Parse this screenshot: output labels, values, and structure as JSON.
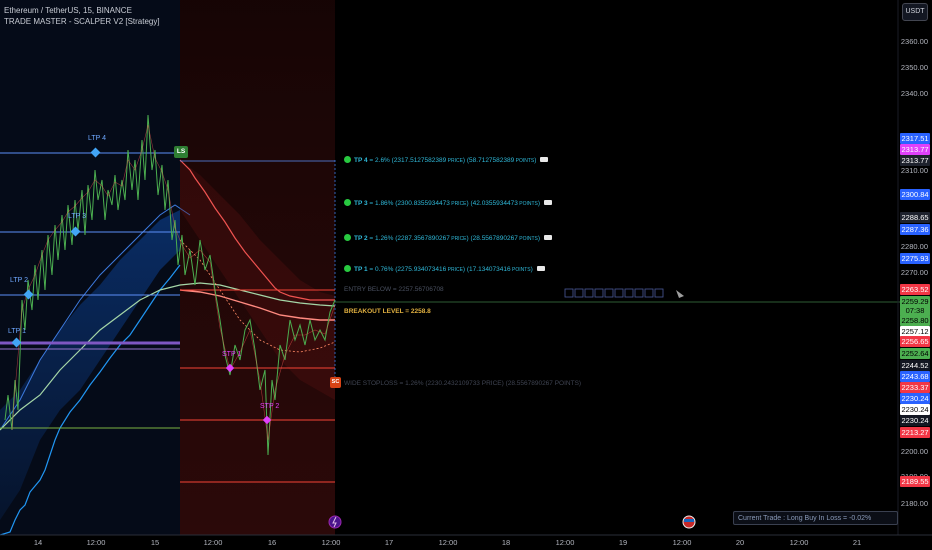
{
  "header": {
    "symbol": "Ethereum / TetherUS, 15, BINANCE",
    "strategy": "TRADE MASTER - SCALPER V2 [Strategy]"
  },
  "currency_button": "USDT",
  "price_axis": [
    "2360.00",
    "2350.00",
    "2340.00",
    "2310.00",
    "2280.00",
    "2270.00",
    "2200.00",
    "2190.00",
    "2180.00"
  ],
  "price_tags": [
    {
      "text": "2317.51",
      "bg": "#2962ff",
      "fg": "#ffffff"
    },
    {
      "text": "2313.77",
      "bg": "#e040fb",
      "fg": "#ffffff"
    },
    {
      "text": "2313.77",
      "bg": "#1e222d",
      "fg": "#ffffff"
    },
    {
      "text": "2300.84",
      "bg": "#2962ff",
      "fg": "#ffffff"
    },
    {
      "text": "2288.65",
      "bg": "#1e222d",
      "fg": "#ffffff"
    },
    {
      "text": "2287.36",
      "bg": "#2962ff",
      "fg": "#ffffff"
    },
    {
      "text": "2275.93",
      "bg": "#2962ff",
      "fg": "#ffffff"
    },
    {
      "text": "2263.52",
      "bg": "#f23645",
      "fg": "#ffffff"
    },
    {
      "text": "2259.29",
      "bg": "#4caf50",
      "fg": "#000000"
    },
    {
      "text": "07:38",
      "bg": "#4caf50",
      "fg": "#000000"
    },
    {
      "text": "2258.80",
      "bg": "#4caf50",
      "fg": "#000000"
    },
    {
      "text": "2257.12",
      "bg": "#ffffff",
      "fg": "#000000"
    },
    {
      "text": "2256.65",
      "bg": "#f23645",
      "fg": "#ffffff"
    },
    {
      "text": "2252.64",
      "bg": "#4caf50",
      "fg": "#000000"
    },
    {
      "text": "2244.52",
      "bg": "#131722",
      "fg": "#ffffff"
    },
    {
      "text": "2243.68",
      "bg": "#2962ff",
      "fg": "#ffffff"
    },
    {
      "text": "2233.37",
      "bg": "#f23645",
      "fg": "#ffffff"
    },
    {
      "text": "2230.24",
      "bg": "#2962ff",
      "fg": "#ffffff"
    },
    {
      "text": "2230.24",
      "bg": "#ffffff",
      "fg": "#000000"
    },
    {
      "text": "2230.24",
      "bg": "#131722",
      "fg": "#ffffff"
    },
    {
      "text": "2213.27",
      "bg": "#f23645",
      "fg": "#ffffff"
    },
    {
      "text": "2189.55",
      "bg": "#f23645",
      "fg": "#ffffff"
    }
  ],
  "time_axis": [
    "14",
    "12:00",
    "15",
    "12:00",
    "16",
    "12:00",
    "17",
    "12:00",
    "18",
    "12:00",
    "19",
    "12:00",
    "20",
    "12:00",
    "21"
  ],
  "targets": [
    {
      "label": "TP 4",
      "eq": " = 2.6% (",
      "price": "2317.5127582389",
      "pw": " PRICE",
      ")": ") (",
      "pts": "58.7127582389",
      "pts_w": " POINTS",
      ")2": ")"
    },
    {
      "label": "TP 3",
      "eq": " = 1.86% (",
      "price": "2300.8355934473",
      "pw": " PRICE",
      ")": ") (",
      "pts": "42.0355934473",
      "pts_w": " POINTS",
      ")2": ")"
    },
    {
      "label": "TP 2",
      "eq": " = 1.26% (",
      "price": "2287.3567890267",
      "pw": " PRICE",
      ")": ") (",
      "pts": "28.5567890267",
      "pts_w": " POINTS",
      ")2": ")"
    },
    {
      "label": "TP 1",
      "eq": " = 0.76% (",
      "price": "2275.934073416",
      "pw": " PRICE",
      ")": ") (",
      "pts": "17.134073416",
      "pts_w": " POINTS",
      ")2": ")"
    }
  ],
  "entry_below": "ENTRY BELOW = 2257.56706708",
  "breakout": "BREAKOUT LEVEL = 2258.8",
  "wide_stop": "WIDE STOPLOSS = 1.26% (2230.2432109733 PRICE) (28.5567890267 POINTS)",
  "markers": {
    "ltp4": "LTP 4",
    "ltp3": "LTP 3",
    "ltp2": "LTP 2",
    "ltp1": "LTP 1",
    "stp1": "STP 1",
    "stp2": "STP 2",
    "ls": "LS",
    "sc": "SC"
  },
  "status_bubble": "Current Trade : Long Buy  In Loss = -0.02%",
  "colors": {
    "tp_text": "#2fb8d8",
    "bull": "#26a69a",
    "bear": "#ef5350",
    "blue_band": "#1e88e5",
    "red_zone": "#3a0a0a"
  }
}
